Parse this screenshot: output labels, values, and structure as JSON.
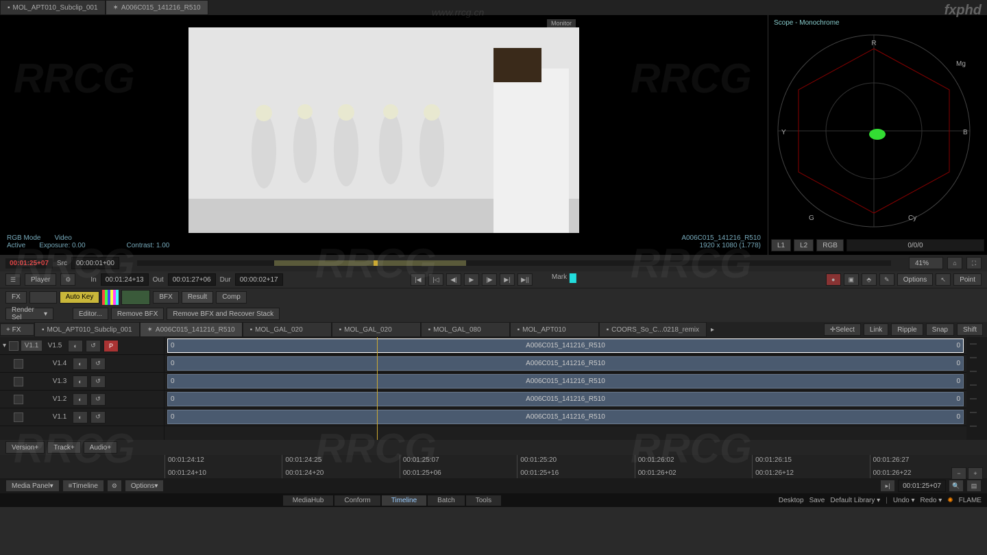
{
  "tabs": {
    "top": [
      {
        "label": "MOL_APT010_Subclip_001",
        "active": false
      },
      {
        "label": "A006C015_141216_R510",
        "active": true
      }
    ]
  },
  "viewer": {
    "monitor_label": "Monitor",
    "info_left": {
      "rgb_mode": "RGB Mode",
      "active": "Active",
      "video": "Video",
      "exposure": "Exposure: 0.00",
      "contrast": "Contrast: 1.00"
    },
    "info_right": {
      "clip": "A006C015_141216_R510",
      "res": "1920 x 1080 (1.778)"
    }
  },
  "scope": {
    "title": "Scope - Monochrome",
    "labels": [
      "R",
      "Mg",
      "B",
      "Cy",
      "G",
      "Y"
    ],
    "readout_L1": "L1",
    "readout_L2": "L2",
    "readout_mode": "RGB",
    "readout_val": "0/0/0",
    "zoom": "41%"
  },
  "tc": {
    "current": "00:01:25+07",
    "src_label": "Src",
    "src_val": "00:00:01+00",
    "in_label": "In",
    "in_val": "00:01:24+13",
    "out_label": "Out",
    "out_val": "00:01:27+06",
    "dur_label": "Dur",
    "dur_val": "00:00:02+17"
  },
  "transport": {
    "player": "Player",
    "mark": "Mark",
    "options": "Options",
    "point": "Point"
  },
  "fx": {
    "fx_label": "FX",
    "autokey": "Auto Key",
    "bfx": "BFX",
    "result": "Result",
    "comp": "Comp",
    "render_sel": "Render Sel",
    "editor": "Editor...",
    "remove_bfx": "Remove BFX",
    "remove_recover": "Remove BFX and Recover Stack",
    "plus_fx": "+ FX"
  },
  "tl_tabs": [
    {
      "label": "MOL_APT010_Subclip_001"
    },
    {
      "label": "A006C015_141216_R510",
      "active": true
    },
    {
      "label": "MOL_GAL_020"
    },
    {
      "label": "MOL_GAL_020"
    },
    {
      "label": "MOL_GAL_080"
    },
    {
      "label": "MOL_APT010"
    },
    {
      "label": "COORS_So_C...0218_remix"
    }
  ],
  "tl_buttons": {
    "select": "Select",
    "link": "Link",
    "ripple": "Ripple",
    "snap": "Snap",
    "shift": "Shift"
  },
  "tracks": [
    {
      "lbl": "V1.1",
      "lbl2": "V1.5",
      "p": "P",
      "clip": "A006C015_141216_R510",
      "sel": true
    },
    {
      "lbl": "",
      "lbl2": "V1.4",
      "clip": "A006C015_141216_R510"
    },
    {
      "lbl": "",
      "lbl2": "V1.3",
      "clip": "A006C015_141216_R510"
    },
    {
      "lbl": "",
      "lbl2": "V1.2",
      "clip": "A006C015_141216_R510"
    },
    {
      "lbl": "",
      "lbl2": "V1.1",
      "clip": "A006C015_141216_R510"
    }
  ],
  "ruler_sections": [
    {
      "top": "00:01:24:12",
      "bottom": "00:01:24+10"
    },
    {
      "top": "00:01:24:25",
      "bottom": "00:01:24+20"
    },
    {
      "top": "00:01:25:07",
      "bottom": "00:01:25+06"
    },
    {
      "top": "00:01:25:20",
      "bottom": "00:01:25+16"
    },
    {
      "top": "00:01:26:02",
      "bottom": "00:01:26+02"
    },
    {
      "top": "00:01:26:15",
      "bottom": "00:01:26+12"
    },
    {
      "top": "00:01:26:27",
      "bottom": "00:01:26+22"
    }
  ],
  "version_row": {
    "version": "Version+",
    "track": "Track+",
    "audio": "Audio+"
  },
  "footer": {
    "media_panel": "Media Panel",
    "timeline": "Timeline",
    "options": "Options",
    "tc": "00:01:25+07",
    "modes": [
      "MediaHub",
      "Conform",
      "Timeline",
      "Batch",
      "Tools"
    ],
    "active_mode": "Timeline",
    "right": {
      "desktop": "Desktop",
      "save": "Save",
      "lib": "Default Library",
      "undo": "Undo",
      "redo": "Redo",
      "app": "FLAME"
    }
  },
  "watermark_url": "www.rrcg.cn",
  "watermark_text": "RRCG",
  "fxphd": "fxphd"
}
